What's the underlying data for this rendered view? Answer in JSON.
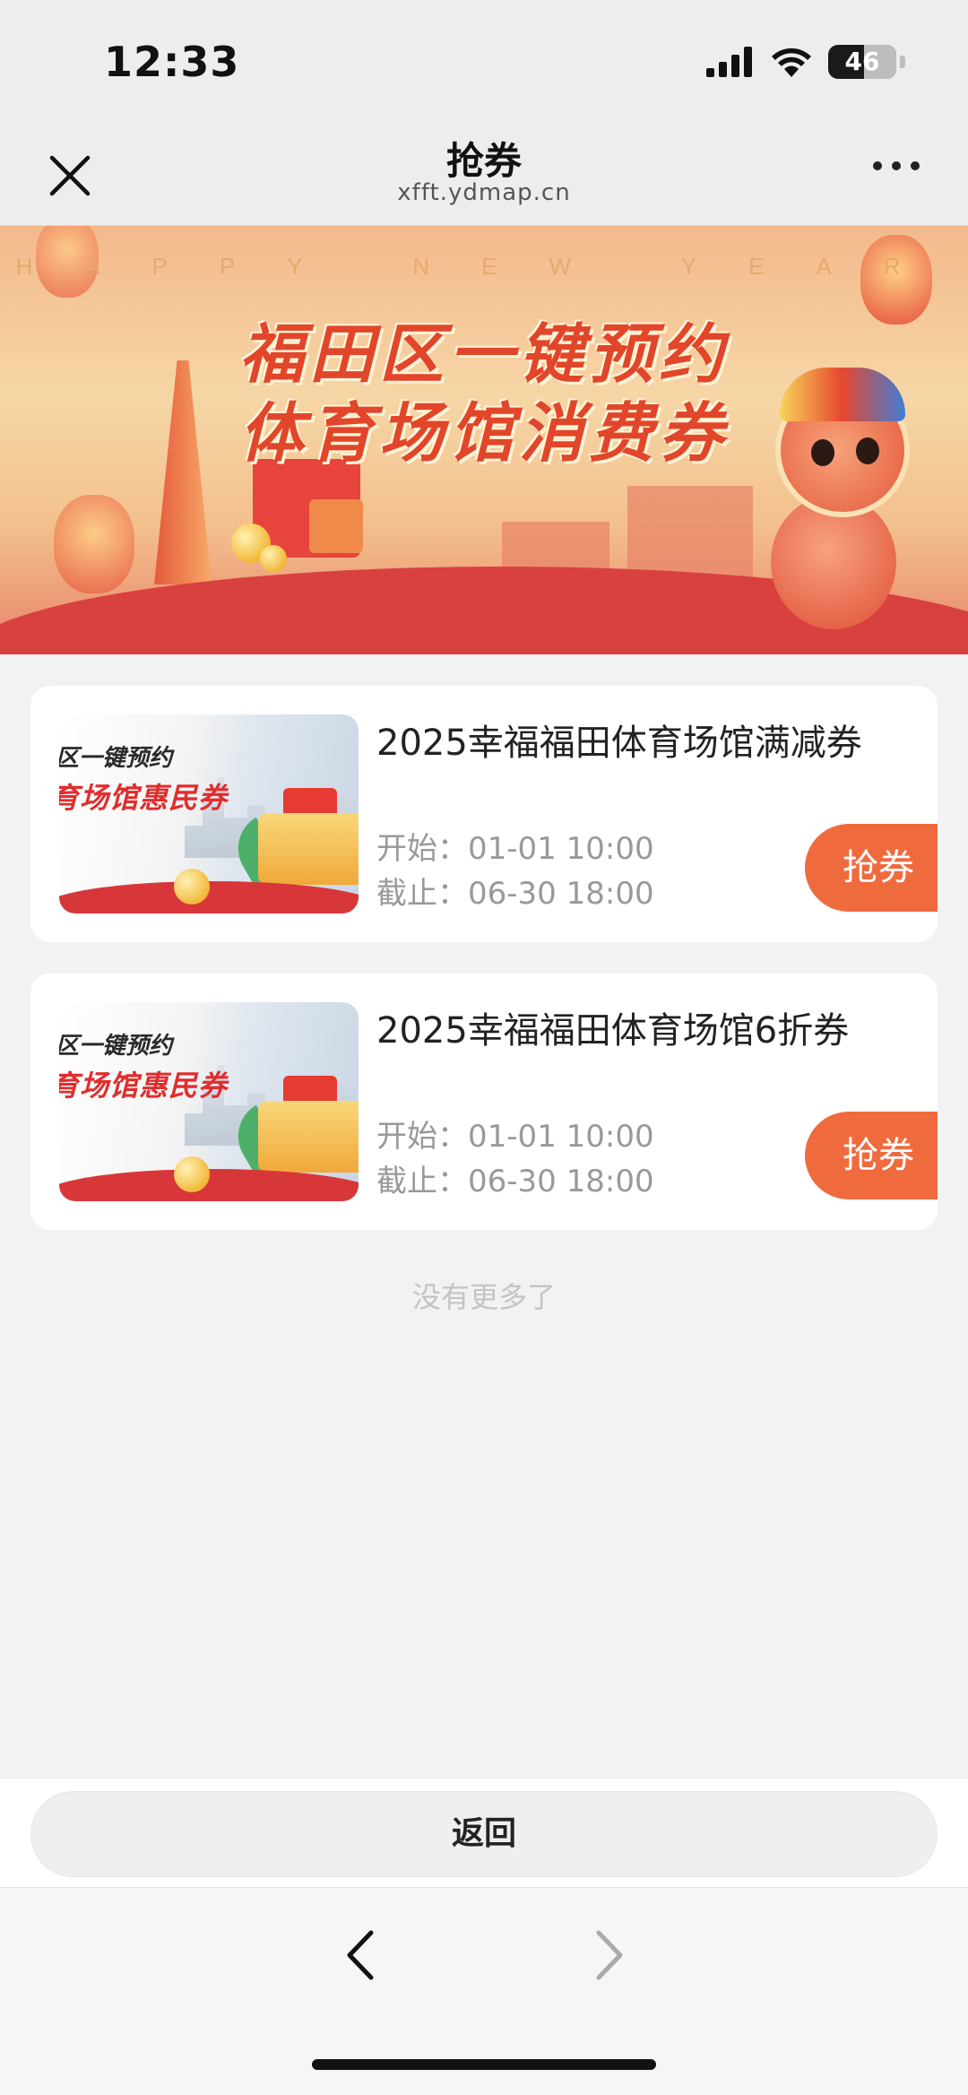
{
  "status_bar": {
    "time": "12:33",
    "battery_level": "46",
    "icons": [
      "signal-icon",
      "wifi-icon",
      "battery-icon"
    ]
  },
  "nav": {
    "title": "抢券",
    "url": "xfft.ydmap.cn",
    "icons": [
      "close-icon",
      "more-icon"
    ]
  },
  "banner": {
    "english_text": "HAPPY NEW YEAR",
    "line1": "福田区一键预约",
    "line2": "体育场馆消费券"
  },
  "coupons": [
    {
      "thumb_line1": "区一键预约",
      "thumb_line2": "育场馆惠民券",
      "title": "2025幸福福田体育场馆满减券",
      "start": "开始：01-01 10:00",
      "end": "截止：06-30 18:00",
      "button": "抢券"
    },
    {
      "thumb_line1": "区一键预约",
      "thumb_line2": "育场馆惠民券",
      "title": "2025幸福福田体育场馆6折券",
      "start": "开始：01-01 10:00",
      "end": "截止：06-30 18:00",
      "button": "抢券"
    }
  ],
  "list_end_text": "没有更多了",
  "footer": {
    "back_label": "返回"
  },
  "browser_nav": {
    "icons": [
      "chevron-left-icon",
      "chevron-right-icon"
    ]
  },
  "colors": {
    "accent": "#ef6b3e",
    "banner_red": "#e2462a",
    "background": "#f2f2f2"
  }
}
